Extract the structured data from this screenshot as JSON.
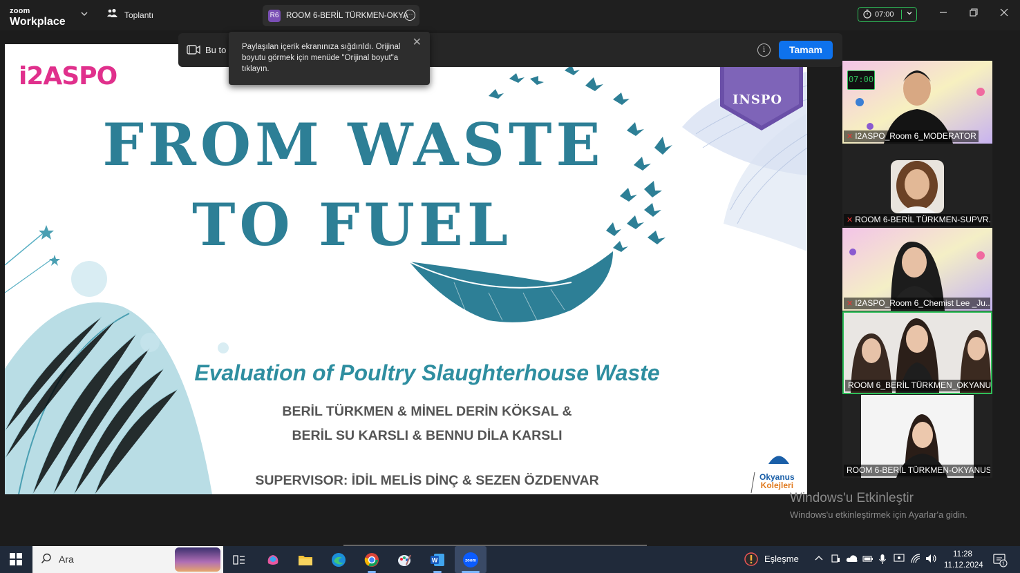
{
  "topbar": {
    "logo_small": "zoom",
    "logo_main": "Workplace",
    "meeting_label": "Toplantı",
    "room_badge": "R6",
    "room_name": "ROOM 6-BERİL TÜRKMEN-OKYA",
    "timer": "07:00",
    "icons": [
      "chevron-down-icon",
      "people-icon",
      "more-icon",
      "timer-icon",
      "minimize-icon",
      "restore-icon",
      "close-icon"
    ],
    "accent_green": "#2fbf5a"
  },
  "banner": {
    "text": "Bu to",
    "ok_button": "Tamam",
    "accent_blue": "#0e72ed"
  },
  "tooltip": {
    "text": "Paylaşılan içerik ekranınıza sığdırıldı. Orijinal boyutu görmek için menüde \"Orijinal boyut\"a tıklayın."
  },
  "slide": {
    "logo_left": "i2ASPO",
    "logo_right": "INSPO",
    "title_line1": "FROM WASTE",
    "title_line2": "TO FUEL",
    "subtitle": "Evaluation of Poultry Slaughterhouse Waste",
    "authors_line1": "BERİL TÜRKMEN & MİNEL DERİN KÖKSAL &",
    "authors_line2": "BERİL SU KARSLI  & BENNU DİLA KARSLI",
    "supervisor": "SUPERVISOR: İDİL MELİS DİNÇ & SEZEN ÖZDENVAR",
    "school_logo_line1": "Okyanus",
    "school_logo_line2": "Kolejleri",
    "title_color": "#2d7f96"
  },
  "participants": [
    {
      "name": "I2ASPO_Room 6_MODERATOR",
      "timer": "07:00",
      "muted": true
    },
    {
      "name": "ROOM 6-BERİL TÜRKMEN-SUPVR...",
      "muted": true
    },
    {
      "name": "I2ASPO_Room 6_Chemist Lee _Ju...",
      "muted": true
    },
    {
      "name": "ROOM 6_BERİL TÜRKMEN_OKYANUS...",
      "muted": false,
      "active": true
    },
    {
      "name": "ROOM 6-BERİL TÜRKMEN-OKYANUS...",
      "muted": false
    }
  ],
  "watermark": {
    "line1": "Windows'u Etkinleştir",
    "line2": "Windows'u etkinleştirmek için Ayarlar'a gidin."
  },
  "taskbar": {
    "search_placeholder": "Ara",
    "tray_label": "Eşleşme",
    "time": "11:28",
    "date": "11.12.2024",
    "notification_count": "1"
  }
}
